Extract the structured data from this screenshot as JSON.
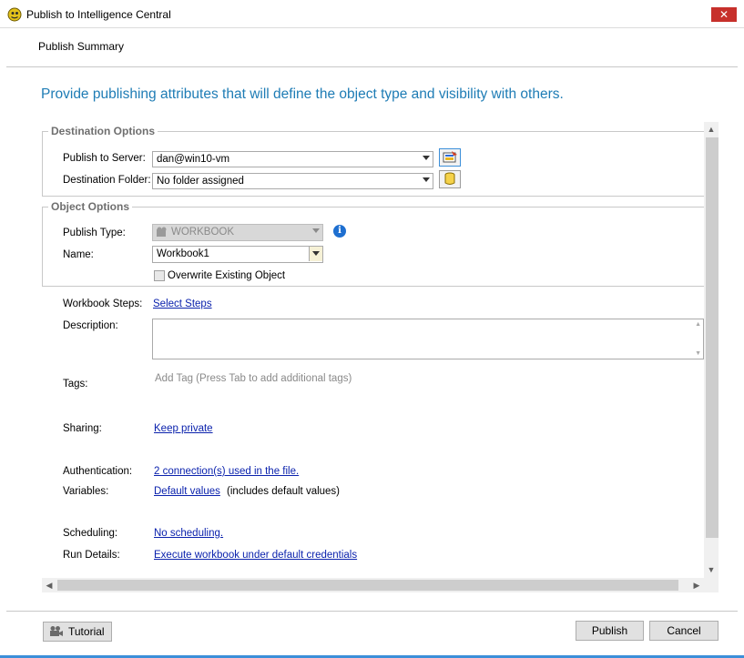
{
  "window": {
    "title": "Publish to Intelligence Central",
    "close_glyph": "✕"
  },
  "header": {
    "subtitle": "Publish Summary"
  },
  "headline": "Provide publishing attributes that will define the object type and visibility with others.",
  "destination_options": {
    "group_title": "Destination Options",
    "server_label": "Publish to Server:",
    "server_value": "dan@win10-vm",
    "folder_label": "Destination Folder:",
    "folder_value": "No folder assigned"
  },
  "object_options": {
    "group_title": "Object Options",
    "type_label": "Publish Type:",
    "type_value": "WORKBOOK",
    "name_label": "Name:",
    "name_value": "Workbook1",
    "overwrite_label": "Overwrite Existing Object"
  },
  "details": {
    "workbook_steps_label": "Workbook Steps:",
    "workbook_steps_link": "Select Steps",
    "description_label": "Description:",
    "description_value": "",
    "tags_label": "Tags:",
    "tags_hint": "Add Tag (Press Tab to add additional tags)",
    "sharing_label": "Sharing:",
    "sharing_link": "Keep private",
    "authentication_label": "Authentication:",
    "authentication_link": "2 connection(s) used in the file.",
    "variables_label": "Variables:",
    "variables_link": "Default values",
    "variables_note": "(includes default values)",
    "scheduling_label": "Scheduling:",
    "scheduling_link": "No scheduling.",
    "run_details_label": "Run Details:",
    "run_details_link": "Execute workbook under default credentials"
  },
  "footer": {
    "tutorial_label": "Tutorial",
    "publish_label": "Publish",
    "cancel_label": "Cancel"
  },
  "icons": {
    "app": "app-icon",
    "server_browse": "server-config-icon",
    "folder": "database-folder-icon",
    "info": "info-icon",
    "tutorial": "film-camera-icon"
  },
  "colors": {
    "accent": "#1e7cb5",
    "link": "#0b22ad",
    "close": "#c7302b"
  }
}
